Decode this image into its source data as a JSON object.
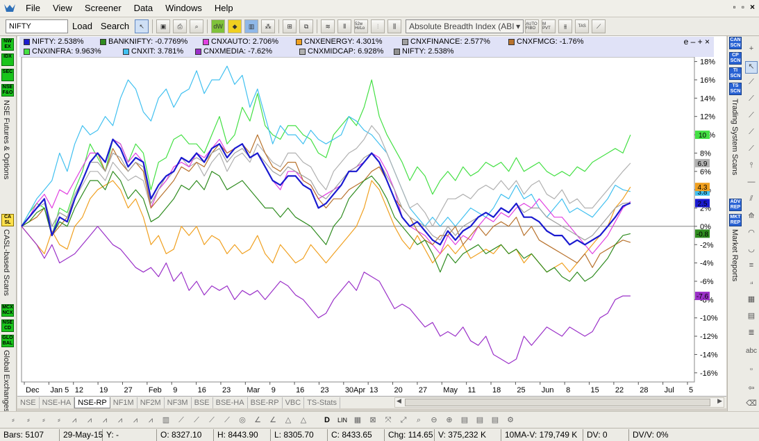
{
  "menu": {
    "items": [
      "File",
      "View",
      "Screener",
      "Data",
      "Windows",
      "Help"
    ],
    "window_controls": [
      "▫",
      "▫",
      "×"
    ]
  },
  "toolbar": {
    "symbol_value": "NIFTY",
    "load_label": "Load",
    "search_label": "Search",
    "indicator_value": "Absolute Breadth Index (ABI",
    "icon_labels": [
      "dW",
      "52w Hi/Lo",
      "AUTO FIBO",
      "M PVT",
      "TAS"
    ]
  },
  "left_panel": {
    "buttons": [
      "NW EX",
      "IDX",
      "SEC",
      "NSE F&O",
      "CA SL",
      "MCX NCX",
      "NSE CD",
      "GLO BAL"
    ],
    "labels": [
      "NSE Futures & Options",
      "CASL-based Scans",
      "Global Exchanges"
    ]
  },
  "right_panel": {
    "buttons": [
      "CAN SCN",
      "CP SCN",
      "TI SCN",
      "TS SCN",
      "ADV REP",
      "MKT REP"
    ],
    "labels": [
      "Trading System Scans",
      "Market Reports"
    ]
  },
  "legend": {
    "controls": "e – + ×",
    "items": [
      {
        "label": "NIFTY: 2.538%",
        "color": "#1a1ad0"
      },
      {
        "label": "BANKNIFTY: -0.7769%",
        "color": "#2e8b1e"
      },
      {
        "label": "CNXAUTO: 2.706%",
        "color": "#e040e0"
      },
      {
        "label": "CNXENERGY: 4.301%",
        "color": "#f0a020"
      },
      {
        "label": "CNXFINANCE: 2.577%",
        "color": "#a0a0a0"
      },
      {
        "label": "CNXFMCG: -1.76%",
        "color": "#b8722c"
      },
      {
        "label": "CNXINFRA: 9.963%",
        "color": "#44e044"
      },
      {
        "label": "CNXIT: 3.781%",
        "color": "#40c0f0"
      },
      {
        "label": "CNXMEDIA: -7.62%",
        "color": "#9a30c8"
      },
      {
        "label": "CNXMIDCAP: 6.928%",
        "color": "#b0b0b0"
      },
      {
        "label": "NIFTY: 2.538%",
        "color": "#909090"
      }
    ]
  },
  "chart_data": {
    "type": "line",
    "x_tick_labels": [
      "Dec",
      "Jan 5",
      "12",
      "19",
      "27",
      "Feb",
      "9",
      "16",
      "23",
      "Mar",
      "9",
      "16",
      "23",
      "30Apr",
      "13",
      "20",
      "27",
      "May",
      "11",
      "18",
      "25",
      "Jun",
      "8",
      "15",
      "22",
      "28",
      "Jul",
      "5"
    ],
    "y_tick_labels": [
      "18%",
      "16%",
      "14%",
      "12%",
      "10%",
      "8%",
      "6%",
      "4%",
      "2%",
      "0%",
      "-2%",
      "-4%",
      "-6%",
      "-8%",
      "-10%",
      "-12%",
      "-14%",
      "-16%"
    ],
    "ylim": [
      -17,
      18.5
    ],
    "series": [
      {
        "name": "CNXINFRA",
        "color": "#44e044",
        "width": 1.2,
        "final_label": "10",
        "values": [
          0,
          1.5,
          2.5,
          2,
          -1,
          2,
          1.5,
          4,
          6,
          9,
          7.5,
          6,
          9.5,
          9,
          7,
          9,
          8,
          4,
          7,
          7.5,
          9.5,
          10,
          9,
          9,
          8,
          10,
          12,
          9,
          10,
          13,
          11.5,
          14.5,
          11,
          10,
          9.5,
          11,
          11,
          10,
          9.5,
          8,
          7.5,
          10,
          11,
          12,
          11,
          13,
          16,
          12,
          10,
          8.5,
          7,
          5,
          6.5,
          5.5,
          3.5,
          5,
          6,
          5,
          6.5,
          5.5,
          6,
          7,
          6.5,
          7,
          6,
          7.5,
          6,
          6.5,
          7,
          6,
          5.5,
          6,
          5.5,
          6.5,
          6,
          7,
          7.5,
          8,
          8.5,
          8,
          10
        ]
      },
      {
        "name": "CNXIT",
        "color": "#40c0f0",
        "width": 1.2,
        "final_label": "3.8",
        "values": [
          0,
          1.5,
          3,
          4,
          5,
          8,
          6,
          9,
          11,
          10,
          10.5,
          12,
          11,
          14,
          16,
          15,
          12.5,
          11.5,
          14,
          15,
          13,
          14.5,
          15,
          17,
          14.5,
          16,
          16,
          17.5,
          15.5,
          16.5,
          13,
          15,
          12,
          9,
          11,
          10,
          10,
          9,
          10.5,
          9.5,
          9,
          9.5,
          10,
          12,
          11.5,
          10.5,
          10,
          9,
          8,
          6,
          4,
          2,
          1,
          0,
          1,
          0,
          1,
          0,
          1,
          2,
          1.5,
          1,
          2,
          3.5,
          3,
          4.5,
          3,
          3.5,
          2,
          1,
          2,
          3,
          1.5,
          2,
          1.5,
          1,
          2,
          3,
          4.5,
          4,
          3.8
        ]
      },
      {
        "name": "CNXMIDCAP",
        "color": "#b0b0b0",
        "width": 1.2,
        "final_label": "6.9",
        "values": [
          0,
          1,
          2,
          2.5,
          0,
          1.5,
          1,
          3,
          4.5,
          6,
          6,
          5,
          7,
          6,
          5,
          5.5,
          5,
          2,
          4,
          5,
          6,
          7.5,
          6.5,
          7,
          5.5,
          7,
          8,
          6,
          7.5,
          8,
          7,
          9,
          8,
          7,
          6.5,
          8,
          8,
          7,
          6.5,
          5,
          4,
          6,
          7,
          8,
          8.5,
          9.5,
          11,
          10,
          8,
          6,
          4,
          2,
          2.5,
          1.5,
          0,
          1.5,
          3,
          3,
          3.5,
          3,
          4,
          4.5,
          4,
          5,
          4,
          5,
          3.5,
          4.5,
          5,
          3.5,
          3,
          4,
          2.5,
          3,
          2,
          2,
          3,
          4,
          5,
          6,
          6.9
        ]
      },
      {
        "name": "CNXENERGY",
        "color": "#f0a020",
        "width": 1.2,
        "final_label": "4.3",
        "values": [
          0,
          -1,
          -2,
          -3,
          -0.5,
          -2,
          -2.5,
          0,
          1,
          3,
          4,
          4.5,
          5,
          4,
          2,
          3,
          1,
          -2,
          -1,
          -3,
          -2.5,
          0,
          -1,
          0,
          -2,
          -1,
          -1.5,
          -3,
          -2,
          -3,
          -2.5,
          -1,
          -3,
          -4,
          -2,
          -3,
          -4,
          -3.5,
          -2,
          -3,
          -4,
          -3,
          -2,
          -1,
          0,
          2,
          5,
          4,
          2,
          0,
          -1.5,
          -2.5,
          -1,
          -2.5,
          -4,
          -3,
          -2,
          -3,
          -2,
          -3.5,
          -3,
          -2.5,
          -3,
          -2,
          -3,
          -2.5,
          -4,
          -3,
          -4,
          -5,
          -4.5,
          -4,
          -5,
          -4,
          -3,
          -2,
          -1,
          0,
          2,
          3,
          4.3
        ]
      },
      {
        "name": "CNXAUTO",
        "color": "#e040e0",
        "width": 1.2,
        "final_label": "",
        "values": [
          0,
          1,
          2.5,
          3.5,
          2,
          4,
          3.5,
          5,
          6.5,
          8,
          8,
          7,
          9.5,
          9,
          7,
          8,
          7,
          2,
          4,
          5,
          6.5,
          7,
          6.5,
          8,
          7.5,
          8.5,
          9.5,
          8,
          8.5,
          9,
          7.5,
          8,
          6.5,
          5,
          4,
          6,
          6,
          5,
          4.5,
          3,
          3.5,
          4,
          4.5,
          6,
          6.5,
          7,
          8,
          7.5,
          6,
          4,
          1,
          0,
          -0.5,
          -1,
          -2,
          -3,
          -1,
          -2,
          -1,
          -1.5,
          0,
          1,
          0.5,
          1.5,
          1,
          2,
          2.5,
          2,
          3,
          2,
          1,
          1,
          0,
          -1,
          -2,
          -3,
          -2,
          -1,
          0.5,
          2,
          2.706
        ]
      },
      {
        "name": "CNXFMCG",
        "color": "#b8722c",
        "width": 1.2,
        "final_label": "",
        "values": [
          0,
          0.5,
          1,
          2,
          -1,
          0,
          1,
          3,
          5,
          7,
          8,
          6,
          8.5,
          7,
          6,
          7,
          6,
          2,
          3,
          4,
          5,
          6.5,
          6,
          7,
          6.5,
          8,
          9,
          8,
          8.5,
          9,
          8,
          10,
          8,
          6.5,
          6,
          7,
          7,
          5,
          4.5,
          3,
          2,
          3,
          3,
          4,
          4.5,
          5,
          6,
          6.5,
          5,
          3,
          2,
          1,
          -0.5,
          -1.5,
          -2,
          -1,
          -1,
          0,
          -2,
          -1,
          0,
          -1,
          0,
          0.5,
          0,
          1,
          -1,
          0,
          -1.5,
          -2,
          -2.5,
          -3,
          -3.5,
          -4,
          -3,
          -4.5,
          -3,
          -2.5,
          -2,
          -1.5,
          -1.76
        ]
      },
      {
        "name": "CNXFINANCE",
        "color": "#a0a0a0",
        "width": 1.2,
        "final_label": "",
        "values": [
          0,
          1,
          2,
          3,
          0,
          1.5,
          1,
          3.5,
          5,
          7,
          7,
          6,
          8,
          7.5,
          6,
          7,
          6.5,
          2.5,
          4,
          5.5,
          6,
          7.5,
          7,
          7.5,
          7,
          8,
          8.5,
          7,
          8,
          8.5,
          7.5,
          8,
          7,
          6,
          5.5,
          6.5,
          6,
          5.5,
          5,
          3.5,
          3,
          4,
          5,
          6,
          6.5,
          7.5,
          8,
          7,
          5.5,
          4,
          2,
          1,
          0.5,
          0,
          -1,
          -1.5,
          0,
          -1,
          0,
          0.5,
          1,
          1.5,
          1,
          2,
          1.5,
          2.5,
          1.5,
          2,
          2,
          1,
          0.5,
          0,
          -0.5,
          -1,
          -1.5,
          -1,
          0,
          1,
          2,
          2.5,
          2.577
        ]
      },
      {
        "name": "BANKNIFTY",
        "color": "#2e8b1e",
        "width": 1.2,
        "final_label": "-0.8",
        "values": [
          0,
          0.5,
          1.5,
          2,
          -1,
          0.5,
          0,
          2,
          3.5,
          5,
          5,
          4,
          6,
          5,
          3,
          4,
          3,
          0.5,
          1,
          2,
          3,
          4.5,
          4,
          5,
          4,
          6,
          5.5,
          4,
          4.5,
          5,
          4,
          3,
          2,
          2,
          1,
          2,
          1,
          0.5,
          0,
          -1,
          -2,
          0,
          1,
          3,
          4,
          5,
          5.5,
          4.5,
          3,
          1,
          0,
          -1,
          -2,
          -1.5,
          -3,
          -5,
          -3,
          -4,
          -3,
          -2.5,
          -2,
          -3,
          -2.5,
          -2,
          -3,
          -2.5,
          -3.5,
          -3,
          -4,
          -5,
          -4.5,
          -5.5,
          -6,
          -5,
          -6,
          -5.5,
          -4.5,
          -3.5,
          -2,
          -1,
          -0.8
        ]
      },
      {
        "name": "CNXMEDIA",
        "color": "#9a30c8",
        "width": 1.2,
        "final_label": "-7.6",
        "values": [
          0,
          -1,
          -2,
          -3.5,
          -2,
          -4,
          -3.5,
          -3,
          -2,
          -1,
          0,
          -1,
          -2,
          -2.5,
          -3.5,
          -4.5,
          -5,
          -4.5,
          -5.5,
          -4,
          -6,
          -5,
          -7,
          -6,
          -7.5,
          -6.5,
          -7,
          -6.5,
          -8,
          -7,
          -7.5,
          -7,
          -8,
          -7,
          -6,
          -6.5,
          -7.5,
          -8,
          -9,
          -10,
          -9.5,
          -8,
          -7,
          -6,
          -7,
          -5,
          -5.5,
          -6,
          -7.5,
          -9,
          -8.5,
          -9,
          -10,
          -11,
          -10.5,
          -12,
          -11.5,
          -12,
          -11,
          -12.5,
          -13,
          -12,
          -14,
          -14.5,
          -15,
          -14.5,
          -12,
          -13,
          -12,
          -11,
          -11.5,
          -12,
          -11,
          -11.5,
          -12,
          -11.5,
          -10,
          -9.5,
          -8,
          -7.6,
          -7.6
        ]
      },
      {
        "name": "NIFTY",
        "color": "#1a1ad0",
        "width": 2.2,
        "final_label": "2.5",
        "values": [
          0,
          1,
          2,
          3,
          -1,
          1,
          0.5,
          3,
          5,
          7,
          8,
          7,
          9.5,
          8.5,
          6.5,
          7.5,
          7,
          3,
          4.5,
          5.5,
          6,
          7.5,
          7,
          8,
          7,
          8.5,
          9,
          7.5,
          8.5,
          9,
          7.5,
          8,
          6.5,
          5,
          4.5,
          5.5,
          5.5,
          4.5,
          4,
          2,
          2.5,
          3.5,
          4.5,
          6,
          6,
          7,
          8,
          7,
          5,
          3,
          1,
          0,
          0.5,
          -0.5,
          -1.5,
          -2,
          -0.5,
          -1.5,
          -0.5,
          0,
          1,
          1.5,
          1,
          2,
          1.5,
          2.5,
          1,
          1,
          0.5,
          -0.5,
          -1,
          -1,
          -2,
          -1.5,
          -2,
          -1.5,
          -1,
          0,
          1,
          2.2,
          2.538
        ]
      }
    ],
    "zero_label": "0%"
  },
  "tabs": [
    "NSE",
    "NSE-HA",
    "NSE-RP",
    "NF1M",
    "NF2M",
    "NF3M",
    "BSE",
    "BSE-HA",
    "BSE-RP",
    "VBC",
    "TS-Stats"
  ],
  "active_tab": "NSE-RP",
  "drawbar": {
    "lin_label": "LIN",
    "d_label": "D"
  },
  "status": {
    "bars": "Bars: 5107",
    "date": "29-May-15",
    "y": "Y: -",
    "open": "O: 8327.10",
    "high": "H: 8443.90",
    "low": "L: 8305.70",
    "close": "C: 8433.65",
    "chg": "Chg: 114.65",
    "vol": "V: 375,232 K",
    "ma": "10MA-V: 179,749 K",
    "dv": "DV: 0",
    "dvv": "DV/V: 0%"
  }
}
